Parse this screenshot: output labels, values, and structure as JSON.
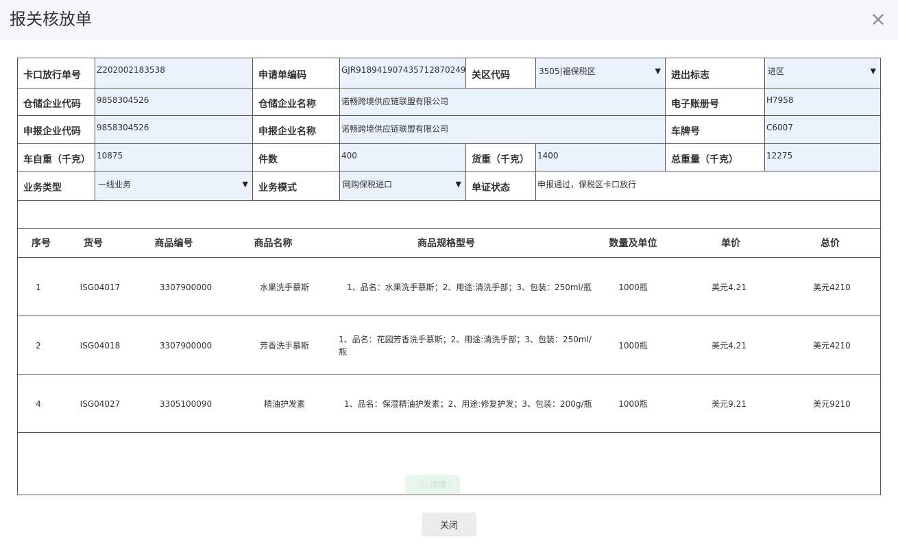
{
  "dialog": {
    "title": "报关核放单",
    "close_symbol": "×"
  },
  "form": {
    "kakou_no_label": "卡口放行单号",
    "kakou_no_value": "Z202002183538",
    "apply_no_label": "申请单编码",
    "apply_no_value": "GJR918941907435712870249",
    "zone_code_label": "关区代码",
    "zone_code_value": "3505|福保税区",
    "io_flag_label": "进出标志",
    "io_flag_value": "进区",
    "storage_code_label": "仓储企业代码",
    "storage_code_value": "9858304526",
    "storage_name_label": "仓储企业名称",
    "storage_name_value": "诺畅跨境供应链联盟有限公司",
    "ebook_label": "电子账册号",
    "ebook_value": "H7958",
    "declare_code_label": "申报企业代码",
    "declare_code_value": "9858304526",
    "declare_name_label": "申报企业名称",
    "declare_name_value": "诺畅跨境供应链联盟有限公司",
    "plate_label": "车牌号",
    "plate_value": "C6007",
    "vehicle_weight_label": "车自重（千克）",
    "vehicle_weight_value": "10875",
    "pieces_label": "件数",
    "pieces_value": "400",
    "cargo_weight_label": "货重（千克）",
    "cargo_weight_value": "1400",
    "total_weight_label": "总重量（千克）",
    "total_weight_value": "12275",
    "biz_type_label": "业务类型",
    "biz_type_value": "一线业务",
    "biz_mode_label": "业务模式",
    "biz_mode_value": "网购保税进口",
    "doc_status_label": "单证状态",
    "doc_status_value": "申报通过，保税区卡口放行",
    "dropdown_arrow": "▼"
  },
  "table": {
    "headers": [
      "序号",
      "货号",
      "商品编号",
      "商品名称",
      "商品规格型号",
      "数量及单位",
      "单价",
      "总价"
    ],
    "rows": [
      [
        "1",
        "ISG04017",
        "3307900000",
        "水果洗手慕斯",
        "1、品名：水果洗手慕斯；2、用途:清洗手部；3、包装：250ml/瓶",
        "1000瓶",
        "美元4.21",
        "美元4210"
      ],
      [
        "2",
        "ISG04018",
        "3307900000",
        "芳香洗手慕斯",
        "1、品名：花园芳香洗手慕斯；2、用途:清洗手部；3、包装：250ml/瓶",
        "1000瓶",
        "美元4.21",
        "美元4210"
      ],
      [
        "4",
        "ISG04027",
        "3305100090",
        "精油护发素",
        "1、品名：保湿精油护发素；2、用途:修复护发；3、包装：200g/瓶",
        "1000瓶",
        "美元9.21",
        "美元9210"
      ]
    ]
  },
  "detail_button": {
    "label": "ⓘ 详情"
  },
  "footer": {
    "close_label": "关闭"
  }
}
